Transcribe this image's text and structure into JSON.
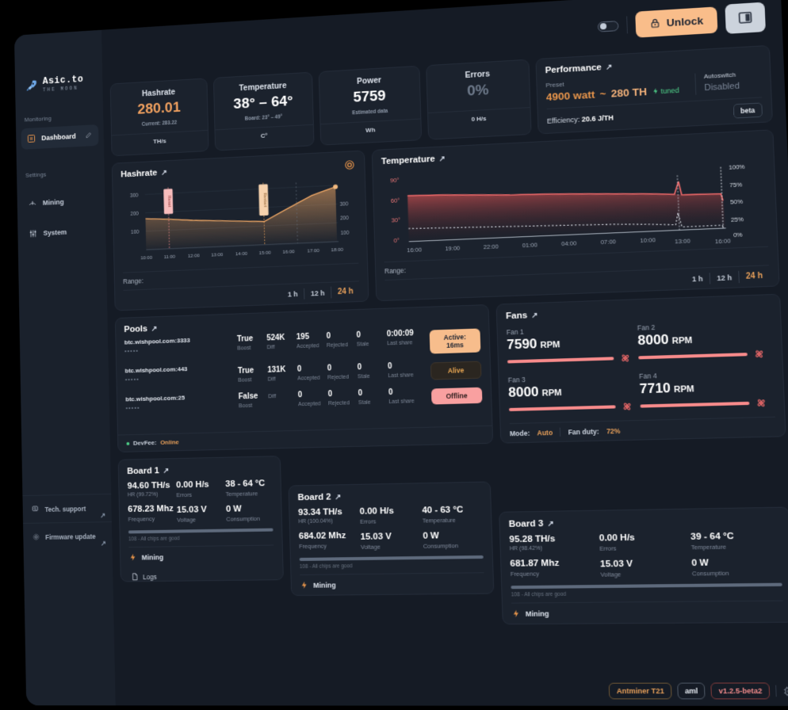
{
  "brand": {
    "title": "Asic.to",
    "subtitle": "THE MOON",
    "icon": "rocket-icon"
  },
  "sidebar": {
    "sections": [
      {
        "label": "Monitoring",
        "items": [
          {
            "label": "Dashboard",
            "icon": "dashboard-icon",
            "active": true,
            "edit": "pencil-icon"
          }
        ]
      },
      {
        "label": "Settings",
        "items": [
          {
            "label": "Mining",
            "icon": "pickaxe-icon",
            "active": false
          },
          {
            "label": "System",
            "icon": "sliders-icon",
            "active": false
          }
        ]
      }
    ],
    "links": [
      {
        "label": "Tech. support",
        "icon": "support-icon",
        "arrow": "↗"
      },
      {
        "label": "Firmware update",
        "icon": "gear-icon",
        "arrow": "↗"
      }
    ]
  },
  "topbar": {
    "toggle_state": "off",
    "unlock_label": "Unlock",
    "unlock_icon": "lock-icon",
    "panel_icon": "panel-layout-icon"
  },
  "kpis": [
    {
      "label": "Hashrate",
      "value": "280.01",
      "value_color": "orange",
      "sub": "Current: 283.22",
      "unit": "TH/s"
    },
    {
      "label": "Temperature",
      "value": "38° – 64°",
      "value_color": "white",
      "sub": "Board: 23° – 49°",
      "unit": "C°"
    },
    {
      "label": "Power",
      "value": "5759",
      "value_color": "white",
      "sub": "Estimated data",
      "unit": "Wh"
    },
    {
      "label": "Errors",
      "value": "0%",
      "value_color": "muted",
      "sub": "",
      "unit": "0 H/s"
    }
  ],
  "performance": {
    "title": "Performance",
    "preset_label": "Preset",
    "preset_watt": "4900 watt",
    "preset_sep": "~",
    "preset_th": "280 TH",
    "tuned_label": "tuned",
    "tuned_icon": "bolt-icon",
    "autoswitch_label": "Autoswitch",
    "autoswitch_value": "Disabled",
    "efficiency_label": "Efficiency:",
    "efficiency_value": "20.6 J/TH",
    "beta_badge": "beta"
  },
  "range": {
    "label": "Range:",
    "options": [
      "1 h",
      "12 h",
      "24 h"
    ],
    "selected": "24 h"
  },
  "chart_data": [
    {
      "type": "area",
      "name": "hashrate-chart",
      "title": "Hashrate",
      "ylabel": "",
      "xlabel": "",
      "yticks": [
        100,
        200,
        300
      ],
      "ylim": [
        0,
        350
      ],
      "xticks": [
        "10:00",
        "11:00",
        "12:00",
        "13:00",
        "14:00",
        "15:00",
        "16:00",
        "17:00",
        "18:00"
      ],
      "x": [
        "10:00",
        "11:00",
        "12:00",
        "13:00",
        "14:00",
        "15:00",
        "16:00",
        "17:00",
        "18:00"
      ],
      "values": [
        168,
        160,
        152,
        146,
        141,
        136,
        175,
        232,
        281
      ],
      "annotations": [
        {
          "label": "Reset",
          "x": "11:00",
          "color": "#f6a9a9"
        },
        {
          "label": "Restart",
          "x": "15:00",
          "color": "#f2bd8e"
        },
        {
          "label": "",
          "x": "16:30",
          "color": "#6e7a8b"
        }
      ],
      "last_point": 281,
      "line_color": "#f0a866",
      "grid": true
    },
    {
      "type": "line",
      "name": "temperature-chart",
      "title": "Temperature",
      "yticks_left": [
        "0°",
        "30°",
        "60°",
        "90°"
      ],
      "yticks_right": [
        "0%",
        "25%",
        "50%",
        "75%",
        "100%"
      ],
      "ylim": [
        0,
        90
      ],
      "xticks": [
        "16:00",
        "19:00",
        "22:00",
        "01:00",
        "04:00",
        "07:00",
        "10:00",
        "13:00",
        "16:00"
      ],
      "series": [
        {
          "name": "chip temperature",
          "color": "#f26b6b",
          "values": [
            66,
            65,
            65,
            64,
            64,
            63,
            63,
            62,
            62,
            61,
            61,
            60,
            59,
            57,
            56,
            55,
            55,
            54,
            54,
            53
          ]
        },
        {
          "name": "fan duty",
          "color": "#d8dde5",
          "values": [
            20,
            20,
            19,
            19,
            19,
            18,
            18,
            18,
            17,
            17,
            17,
            16,
            16,
            15,
            15,
            14,
            14,
            13,
            13,
            12
          ]
        }
      ],
      "grid": false
    }
  ],
  "pools": {
    "title": "Pools",
    "columns": [
      "Boost",
      "Diff",
      "Accepted",
      "Rejected",
      "Stale",
      "Last share"
    ],
    "rows": [
      {
        "url": "btc.wishpool.com:3333",
        "password": "•••••",
        "boost": "True",
        "diff": "524K",
        "accepted": "195",
        "rejected": "0",
        "stale": "0",
        "last_share": "0:00:09",
        "status": "Active: 16ms",
        "status_kind": "active"
      },
      {
        "url": "btc.wishpool.com:443",
        "password": "•••••",
        "boost": "True",
        "diff": "131K",
        "accepted": "0",
        "rejected": "0",
        "stale": "0",
        "last_share": "0",
        "status": "Alive",
        "status_kind": "alive"
      },
      {
        "url": "btc.wishpool.com:25",
        "password": "•••••",
        "boost": "False",
        "diff": "",
        "accepted": "0",
        "rejected": "0",
        "stale": "0",
        "last_share": "0",
        "status": "Offline",
        "status_kind": "offline"
      }
    ],
    "devfee_label": "DevFee:",
    "devfee_value": "Online"
  },
  "fans": {
    "title": "Fans",
    "items": [
      {
        "name": "Fan 1",
        "value": "7590",
        "unit": "RPM",
        "percent": 95
      },
      {
        "name": "Fan 2",
        "value": "8000",
        "unit": "RPM",
        "percent": 100
      },
      {
        "name": "Fan 3",
        "value": "8000",
        "unit": "RPM",
        "percent": 100
      },
      {
        "name": "Fan 4",
        "value": "7710",
        "unit": "RPM",
        "percent": 96
      }
    ],
    "mode_label": "Mode:",
    "mode_value": "Auto",
    "duty_label": "Fan duty:",
    "duty_value": "72%"
  },
  "boards": [
    {
      "title": "Board 1",
      "hashrate": "94.60 TH/s",
      "hr": "HR (99.72%)",
      "frequency": "678.23 Mhz",
      "frequency_key": "Frequency",
      "errors": "0.00 H/s",
      "errors_key": "Errors",
      "voltage": "15.03 V",
      "voltage_key": "Voltage",
      "temperature": "38 - 64 °C",
      "temperature_key": "Temperature",
      "consumption": "0 W",
      "consumption_key": "Consumption",
      "chips": "108 - All chips are good",
      "status": "Mining",
      "status_icon": "bolt-icon"
    },
    {
      "title": "Board 2",
      "hashrate": "93.34 TH/s",
      "hr": "HR (100.04%)",
      "frequency": "684.02 Mhz",
      "frequency_key": "Frequency",
      "errors": "0.00 H/s",
      "errors_key": "Errors",
      "voltage": "15.03 V",
      "voltage_key": "Voltage",
      "temperature": "40 - 63 °C",
      "temperature_key": "Temperature",
      "consumption": "0 W",
      "consumption_key": "Consumption",
      "chips": "108 - All chips are good",
      "status": "Mining",
      "status_icon": "bolt-icon"
    },
    {
      "title": "Board 3",
      "hashrate": "95.28 TH/s",
      "hr": "HR (98.42%)",
      "frequency": "681.87 Mhz",
      "frequency_key": "Frequency",
      "errors": "0.00 H/s",
      "errors_key": "Errors",
      "voltage": "15.03 V",
      "voltage_key": "Voltage",
      "temperature": "39 - 64 °C",
      "temperature_key": "Temperature",
      "consumption": "0 W",
      "consumption_key": "Consumption",
      "chips": "108 - All chips are good",
      "status": "Mining",
      "status_icon": "bolt-icon"
    }
  ],
  "logs_label": "Logs",
  "footer": {
    "model": "Antminer T21",
    "aml": "aml",
    "version": "v1.2.5-beta2",
    "settings_icon": "chip-gear-icon"
  },
  "colors": {
    "accent": "#e8a05a",
    "unlock": "#f9bd8a",
    "danger": "#f26b6b",
    "ok": "#4fd38a",
    "bg": "#151b25",
    "card": "#1b222d",
    "sidebar": "#1a212c"
  }
}
